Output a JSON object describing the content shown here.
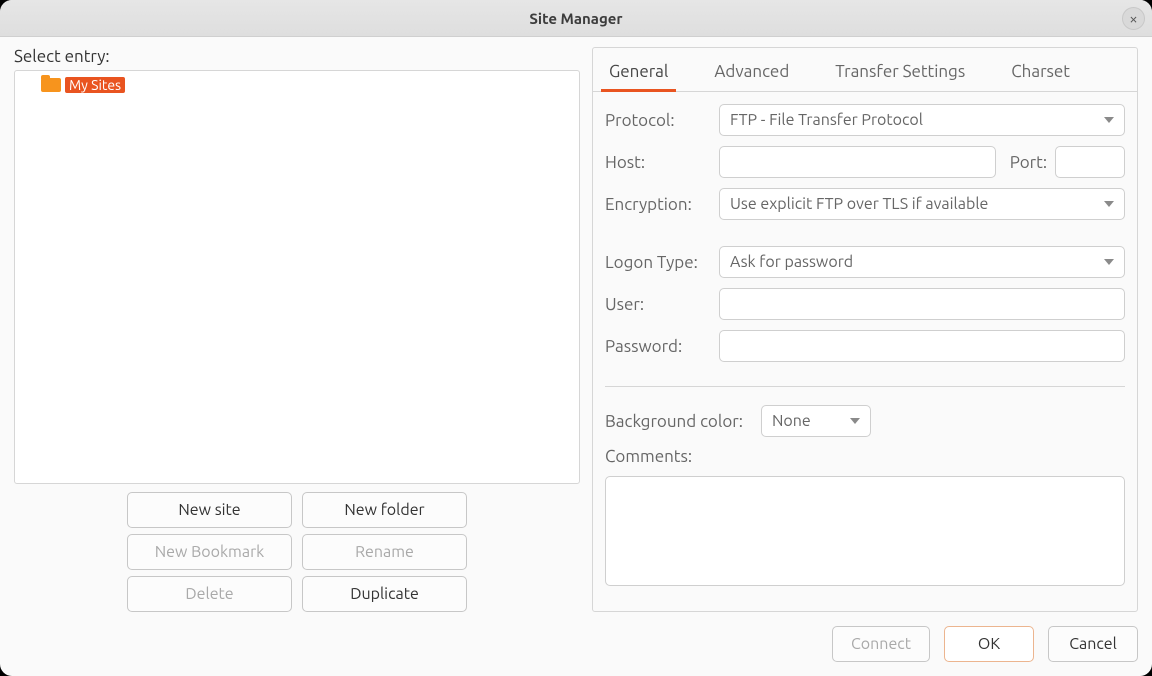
{
  "window": {
    "title": "Site Manager"
  },
  "left": {
    "select_label": "Select entry:",
    "tree_root": "My Sites",
    "buttons": {
      "new_site": "New site",
      "new_folder": "New folder",
      "new_bookmark": "New Bookmark",
      "rename": "Rename",
      "delete": "Delete",
      "duplicate": "Duplicate"
    }
  },
  "tabs": {
    "general": "General",
    "advanced": "Advanced",
    "transfer": "Transfer Settings",
    "charset": "Charset"
  },
  "general": {
    "protocol_label": "Protocol:",
    "protocol_value": "FTP - File Transfer Protocol",
    "host_label": "Host:",
    "host_value": "",
    "port_label": "Port:",
    "port_value": "",
    "encryption_label": "Encryption:",
    "encryption_value": "Use explicit FTP over TLS if available",
    "logon_label": "Logon Type:",
    "logon_value": "Ask for password",
    "user_label": "User:",
    "user_value": "",
    "password_label": "Password:",
    "password_value": "",
    "bgcolor_label": "Background color:",
    "bgcolor_value": "None",
    "comments_label": "Comments:",
    "comments_value": ""
  },
  "footer": {
    "connect": "Connect",
    "ok": "OK",
    "cancel": "Cancel"
  }
}
